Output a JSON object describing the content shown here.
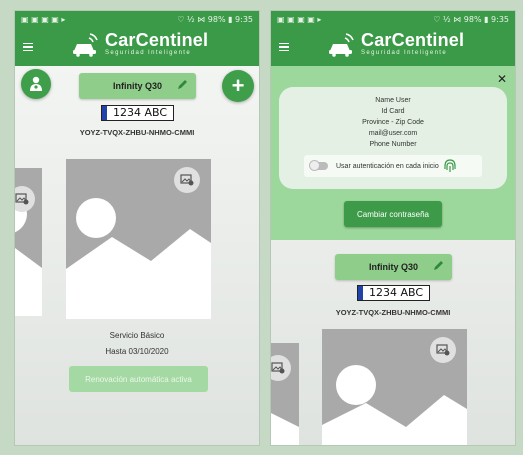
{
  "status_bar": {
    "left": "▣ ▣ ▣ ▣ ▸",
    "right": "♡ ½ ⋈ 98% ▮ 9:35"
  },
  "app": {
    "brand_name": "CarCentinel",
    "brand_tagline": "Seguridad Inteligente",
    "accent_color": "#3b9a48"
  },
  "vehicle": {
    "name": "Infinity Q30",
    "plate": "1234 ABC",
    "code": "YOYZ-TVQX-ZHBU-NHMO-CMMI"
  },
  "plan": {
    "name": "Servicio Básico",
    "valid_until": "Hasta 03/10/2020",
    "renew_button": "Renovación automática activa"
  },
  "user": {
    "name": "Name User",
    "id_card": "Id Card",
    "location": "Province - Zip Code",
    "email": "mail@user.com",
    "phone": "Phone Number",
    "auth_label": "Usar autenticación en cada inicio",
    "auth_enabled": false,
    "change_password_button": "Cambiar contraseña"
  },
  "icons": {
    "menu": "hamburger-icon",
    "logo": "car-signal-icon",
    "profile": "user-profile-icon",
    "add": "plus-icon",
    "edit": "pencil-icon",
    "add_photo": "add-photo-icon",
    "fingerprint": "fingerprint-icon",
    "close": "close-icon"
  }
}
